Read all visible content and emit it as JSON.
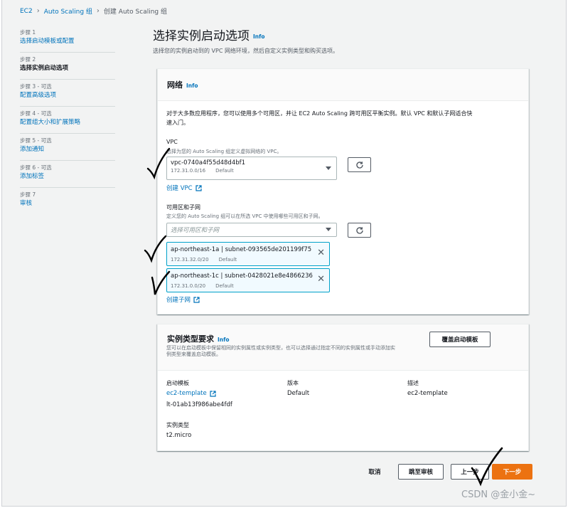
{
  "breadcrumb": {
    "items": [
      "EC2",
      "Auto Scaling 组"
    ],
    "current": "创建 Auto Scaling 组"
  },
  "steps": [
    {
      "meta": "步骤 1",
      "name": "选择启动模板或配置",
      "link": true
    },
    {
      "meta": "步骤 2",
      "name": "选择实例启动选项",
      "link": false
    },
    {
      "meta": "步骤 3 - 可选",
      "name": "配置高级选项",
      "link": true
    },
    {
      "meta": "步骤 4 - 可选",
      "name": "配置组大小和扩展策略",
      "link": true
    },
    {
      "meta": "步骤 5 - 可选",
      "name": "添加通知",
      "link": true
    },
    {
      "meta": "步骤 6 - 可选",
      "name": "添加标签",
      "link": true
    },
    {
      "meta": "步骤 7",
      "name": "审核",
      "link": true
    }
  ],
  "page": {
    "title": "选择实例启动选项",
    "info": "Info",
    "subtitle": "选择您的实例启动到的 VPC 网络环境，然后自定义实例类型和购买选项。"
  },
  "network": {
    "title": "网络",
    "info": "Info",
    "description_line1": "对于大多数应用程序，您可以使用多个可用区，并让 EC2 Auto Scaling 跨可用区平衡实例。默认 VPC 和默认子网适合快",
    "description_line2": "速入门。",
    "vpc_label": "VPC",
    "vpc_desc": "选择为您的 Auto Scaling 组定义虚拟网络的 VPC。",
    "vpc_value": "vpc-0740a4f55d48d4bf1",
    "vpc_cidr": "172.31.0.0/16",
    "vpc_tag": "Default",
    "create_vpc": "创建 VPC",
    "az_label": "可用区和子网",
    "az_desc": "定义您的 Auto Scaling 组可以在所选 VPC 中使用哪些可用区和子网。",
    "az_placeholder": "选择可用区和子网",
    "subnets": [
      {
        "name": "ap-northeast-1a | subnet-093565de201199f75",
        "cidr": "172.31.32.0/20",
        "tag": "Default"
      },
      {
        "name": "ap-northeast-1c | subnet-0428021e8e4866236",
        "cidr": "172.31.0.0/20",
        "tag": "Default"
      }
    ],
    "create_subnet": "创建子网"
  },
  "instance": {
    "title": "实例类型要求",
    "info": "Info",
    "desc_line1": "您可以在启动模板中保留相同的实例属性或实例类型，也可以选择通过指定不同的实例属性或手动添加实",
    "desc_line2": "例类型来覆盖启动模板。",
    "override_button": "覆盖启动模板",
    "col_template_label": "启动模板",
    "template_name": "ec2-template",
    "template_id": "lt-01ab13f986abe4fdf",
    "col_version_label": "版本",
    "version_value": "Default",
    "col_desc_label": "描述",
    "desc_value": "ec2-template",
    "type_label": "实例类型",
    "type_value": "t2.micro"
  },
  "footer": {
    "cancel": "取消",
    "skip_review": "跳至审核",
    "prev": "上一步",
    "next": "下一步"
  },
  "watermark": "CSDN @金小金~",
  "colors": {
    "primary": "#ec7211",
    "link": "#0073bb",
    "token_border": "#00a1c9"
  }
}
